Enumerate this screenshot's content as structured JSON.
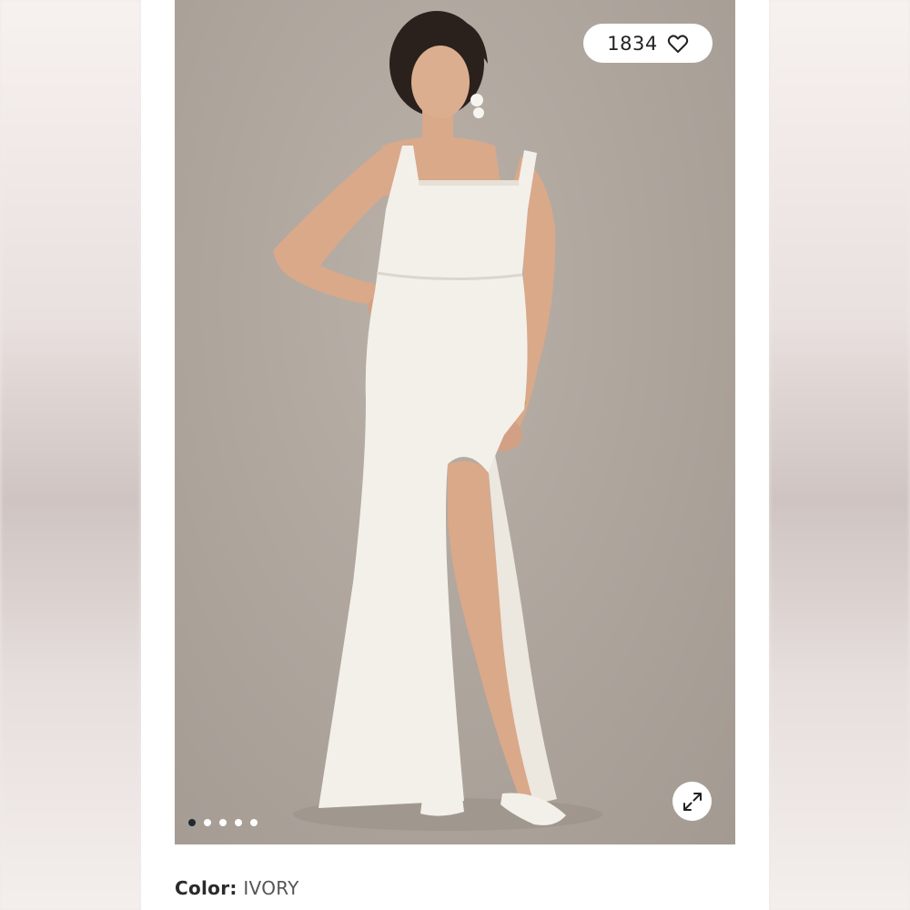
{
  "gallery": {
    "image_alt": "Model wearing ivory square-neck maxi dress with leg slit",
    "slide_count": 5,
    "active_slide": 0
  },
  "likes": {
    "count": "1834",
    "icon": "heart-outline-icon"
  },
  "expand": {
    "icon": "expand-arrows-icon"
  },
  "product": {
    "color_label": "Color:",
    "color_value": "IVORY"
  },
  "colors": {
    "backdrop": "#aea59d",
    "dress": "#f3f0ea",
    "skin": "#d9a98a",
    "hair": "#2b211c",
    "active_dot": "#1f2a33",
    "panel": "#ffffff"
  }
}
